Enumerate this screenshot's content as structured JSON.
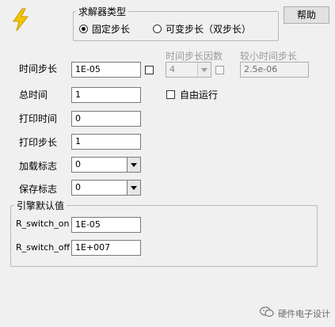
{
  "app_icon": "lightning-icon",
  "solver_group": {
    "title": "求解器类型",
    "options": [
      {
        "label": "固定步长",
        "selected": true
      },
      {
        "label": "可变步长（双步长）",
        "selected": false
      }
    ]
  },
  "help_button": {
    "label": "帮助"
  },
  "params": {
    "time_step": {
      "label": "时间步长",
      "value": "1E-05",
      "checked": false
    },
    "total_time": {
      "label": "总时间",
      "value": "1"
    },
    "print_time": {
      "label": "打印时间",
      "value": "0"
    },
    "print_step": {
      "label": "打印步长",
      "value": "1"
    },
    "load_flag": {
      "label": "加载标志",
      "value": "0"
    },
    "save_flag": {
      "label": "保存标志",
      "value": "0"
    }
  },
  "step_factor": {
    "label": "时间步长因数",
    "value": "4",
    "checked": false,
    "enabled": false
  },
  "min_step": {
    "label": "较小时间步长",
    "value": "2.5e-06",
    "enabled": false
  },
  "free_run": {
    "label": "自由运行",
    "checked": false
  },
  "engine_group": {
    "title": "引擎默认值",
    "r_switch_on": {
      "label": "R_switch_on",
      "value": "1E-05"
    },
    "r_switch_off": {
      "label": "R_switch_off",
      "value": "1E+007"
    }
  },
  "watermark": {
    "text": "硬件电子设计",
    "icon": "wechat-icon"
  },
  "colors": {
    "window_bg": "#f0f0f0",
    "logo_yellow": "#f5c400"
  }
}
